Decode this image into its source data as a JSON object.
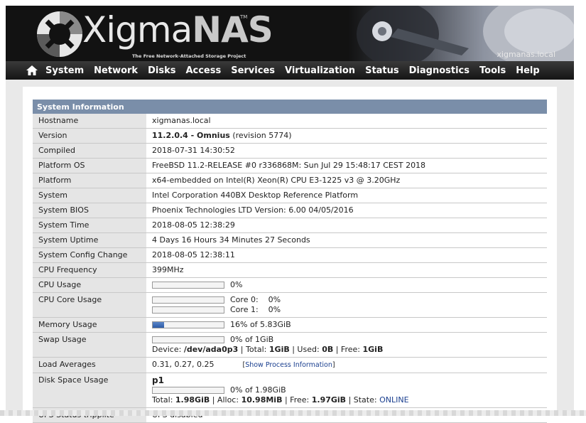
{
  "header": {
    "brand_prefix": "Xigma",
    "brand_suffix": "NAS",
    "trademark": "TM",
    "tagline": "The Free Network-Attached Storage Project",
    "hostname": "xigmanas.local"
  },
  "nav": {
    "home_icon": "home-icon",
    "items": [
      "System",
      "Network",
      "Disks",
      "Access",
      "Services",
      "Virtualization",
      "Status",
      "Diagnostics",
      "Tools",
      "Help"
    ]
  },
  "panel": {
    "title": "System Information",
    "rows": {
      "hostname": {
        "label": "Hostname",
        "value": "xigmanas.local"
      },
      "version": {
        "label": "Version",
        "value_bold": "11.2.0.4 - Omnius",
        "value_rest": "(revision 5774)"
      },
      "compiled": {
        "label": "Compiled",
        "value": "2018-07-31 14:30:52"
      },
      "platform_os": {
        "label": "Platform OS",
        "value": "FreeBSD 11.2-RELEASE #0 r336868M: Sun Jul 29 15:48:17 CEST 2018"
      },
      "platform": {
        "label": "Platform",
        "value": "x64-embedded on Intel(R) Xeon(R) CPU E3-1225 v3 @ 3.20GHz"
      },
      "system": {
        "label": "System",
        "value": "Intel Corporation 440BX Desktop Reference Platform"
      },
      "system_bios": {
        "label": "System BIOS",
        "value": "Phoenix Technologies LTD Version: 6.00 04/05/2016"
      },
      "system_time": {
        "label": "System Time",
        "value": "2018-08-05 12:38:29"
      },
      "system_uptime": {
        "label": "System Uptime",
        "value": "4 Days 16 Hours 34 Minutes 27 Seconds"
      },
      "config_change": {
        "label": "System Config Change",
        "value": "2018-08-05 12:38:11"
      },
      "cpu_freq": {
        "label": "CPU Frequency",
        "value": "399MHz"
      },
      "cpu_usage": {
        "label": "CPU Usage",
        "percent": 0,
        "text": "0%"
      },
      "cpu_core_usage": {
        "label": "CPU Core Usage",
        "cores": [
          {
            "name": "Core 0:",
            "percent": 0,
            "text": "0%"
          },
          {
            "name": "Core 1:",
            "percent": 0,
            "text": "0%"
          }
        ]
      },
      "memory_usage": {
        "label": "Memory Usage",
        "percent": 16,
        "text": "16% of 5.83GiB"
      },
      "swap_usage": {
        "label": "Swap Usage",
        "percent": 0,
        "text": "0% of 1GiB",
        "device_label": "Device:",
        "device": "/dev/ada0p3",
        "total_label": "| Total:",
        "total": "1GiB",
        "used_label": "| Used:",
        "used": "0B",
        "free_label": "| Free:",
        "free": "1GiB"
      },
      "load_averages": {
        "label": "Load Averages",
        "value": "0.31, 0.27, 0.25",
        "link_open": "[",
        "link": "Show Process Information",
        "link_close": "]"
      },
      "disk_space": {
        "label": "Disk Space Usage",
        "pool": "p1",
        "percent": 0,
        "text": "0% of 1.98GiB",
        "total_label": "Total:",
        "total": "1.98GiB",
        "alloc_label": "| Alloc:",
        "alloc": "10.98MiB",
        "free_label": "| Free:",
        "free": "1.97GiB",
        "state_label": "| State:",
        "state": "ONLINE"
      },
      "ups": {
        "label": "UPS Status tripplite",
        "value": "UPS disabled"
      }
    }
  }
}
